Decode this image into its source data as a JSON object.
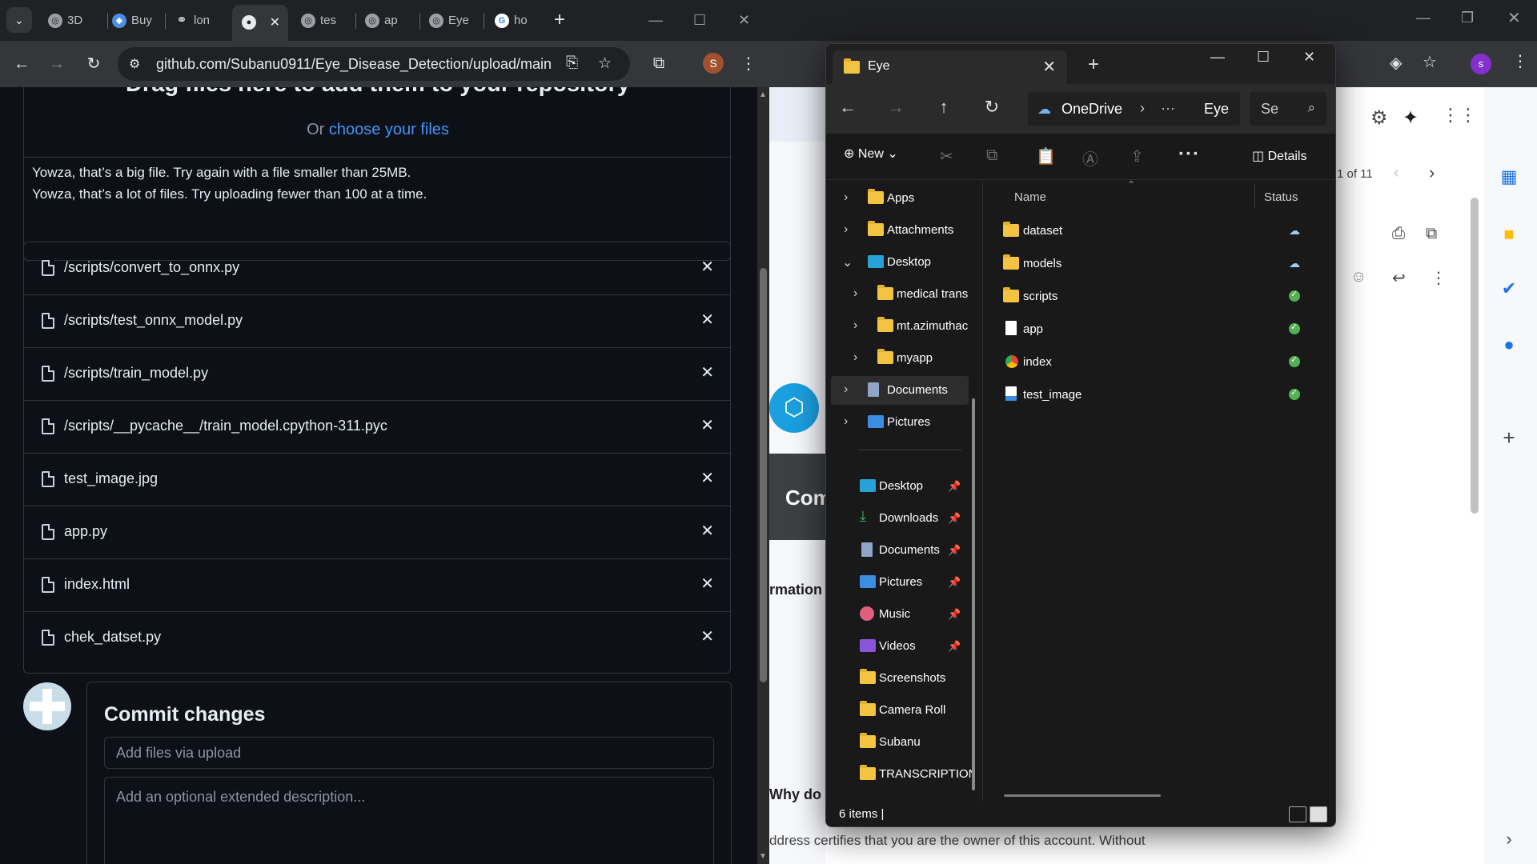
{
  "left_browser": {
    "tabs": [
      {
        "label": "3D",
        "favicon": "globe-icon"
      },
      {
        "label": "Buy",
        "favicon": "cube-icon"
      },
      {
        "label": "lon",
        "favicon": "link-icon"
      },
      {
        "label": "",
        "favicon": "github-icon",
        "active": true
      },
      {
        "label": "tes",
        "favicon": "globe-icon"
      },
      {
        "label": "ap",
        "favicon": "globe-icon"
      },
      {
        "label": "Eye",
        "favicon": "globe-icon"
      },
      {
        "label": "ho",
        "favicon": "google-icon"
      }
    ],
    "url": "github.com/Subanu0911/Eye_Disease_Detection/upload/main",
    "profile_initial": "S"
  },
  "upload": {
    "drop_title": "Drag files here to add them to your repository",
    "drop_prefix": "Or ",
    "drop_link": "choose your files",
    "errors": [
      "Yowza, that’s a big file. Try again with a file smaller than 25MB.",
      "Yowza, that’s a lot of files. Try uploading fewer than 100 at a time."
    ],
    "files": [
      "/scripts/convert_to_onnx.py",
      "/scripts/test_onnx_model.py",
      "/scripts/train_model.py",
      "/scripts/__pycache__/train_model.cpython-311.pyc",
      "test_image.jpg",
      "app.py",
      "index.html",
      "chek_datset.py"
    ]
  },
  "commit": {
    "title": "Commit changes",
    "summary_placeholder": "Add files via upload",
    "description_placeholder": "Add an optional extended description..."
  },
  "right_browser": {
    "pagination": "1 of 11",
    "partial_heading": "Com",
    "partial_text_1": "rmation",
    "partial_text_2": "Why do",
    "partial_text_3": "ddress certifies that you are the owner of this account. Without",
    "profile_initial": "S",
    "small_profile_initial": "s"
  },
  "explorer": {
    "window_title": "Eye",
    "breadcrumb_root": "OneDrive",
    "breadcrumb_more": "···",
    "breadcrumb_current": "Eye",
    "search_placeholder": "Se",
    "new_label": "New",
    "details_label": "Details",
    "tree": [
      {
        "label": "Apps",
        "level": 0,
        "icon": "folder"
      },
      {
        "label": "Attachments",
        "level": 0,
        "icon": "folder"
      },
      {
        "label": "Desktop",
        "level": 0,
        "icon": "desktop",
        "expanded": true
      },
      {
        "label": "medical trans",
        "level": 1,
        "icon": "folder"
      },
      {
        "label": "mt.azimuthac",
        "level": 1,
        "icon": "folder"
      },
      {
        "label": "myapp",
        "level": 1,
        "icon": "folder"
      },
      {
        "label": "Documents",
        "level": 0,
        "icon": "documents",
        "selected": true
      },
      {
        "label": "Pictures",
        "level": 0,
        "icon": "pictures"
      }
    ],
    "quick_access": [
      {
        "label": "Desktop",
        "icon": "desktop",
        "pinned": true
      },
      {
        "label": "Downloads",
        "icon": "downloads",
        "pinned": true
      },
      {
        "label": "Documents",
        "icon": "documents",
        "pinned": true
      },
      {
        "label": "Pictures",
        "icon": "pictures",
        "pinned": true
      },
      {
        "label": "Music",
        "icon": "music",
        "pinned": true
      },
      {
        "label": "Videos",
        "icon": "videos",
        "pinned": true
      },
      {
        "label": "Screenshots",
        "icon": "folder",
        "pinned": false
      },
      {
        "label": "Camera Roll",
        "icon": "folder",
        "pinned": false
      },
      {
        "label": "Subanu",
        "icon": "folder",
        "pinned": false
      },
      {
        "label": "TRANSCRIPTION",
        "icon": "folder",
        "pinned": false
      }
    ],
    "columns": {
      "name": "Name",
      "status": "Status"
    },
    "items": [
      {
        "name": "dataset",
        "type": "folder",
        "status": "cloud"
      },
      {
        "name": "models",
        "type": "folder",
        "status": "cloud"
      },
      {
        "name": "scripts",
        "type": "folder",
        "status": "synced"
      },
      {
        "name": "app",
        "type": "file",
        "status": "synced"
      },
      {
        "name": "index",
        "type": "html",
        "status": "synced"
      },
      {
        "name": "test_image",
        "type": "image",
        "status": "synced"
      }
    ],
    "status_bar": "6 items  |"
  },
  "colors": {
    "github_bg": "#0d1117",
    "github_link": "#4493f8",
    "explorer_bg": "#191919",
    "folder": "#f5c342",
    "synced": "#54b054"
  }
}
